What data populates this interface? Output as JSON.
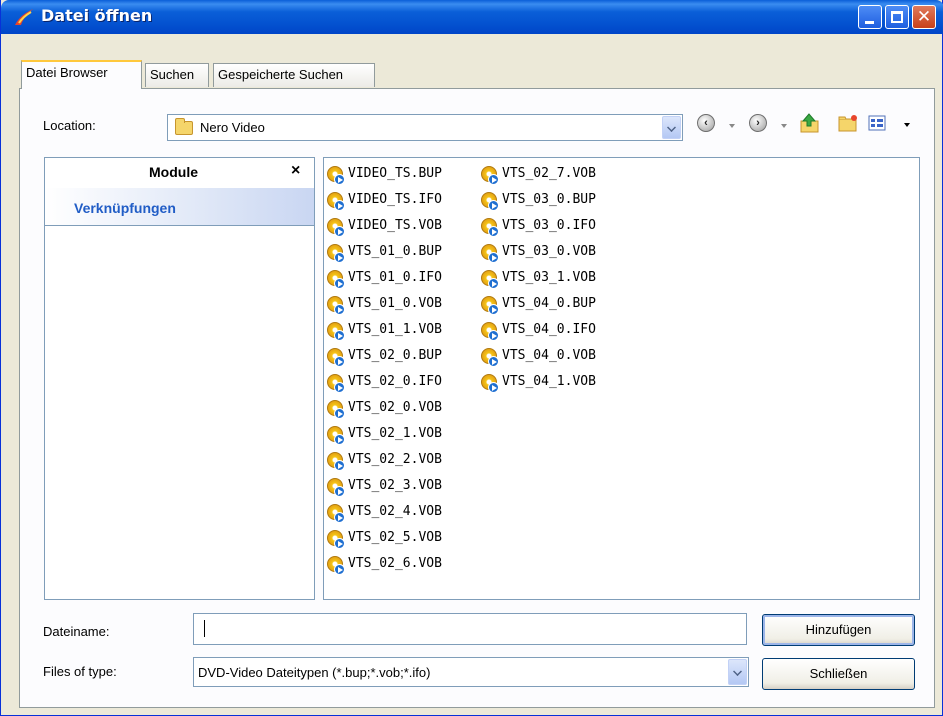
{
  "window": {
    "title": "Datei öffnen"
  },
  "tabs": [
    {
      "label": "Datei Browser",
      "active": true
    },
    {
      "label": "Suchen",
      "active": false
    },
    {
      "label": "Gespeicherte Suchen",
      "active": false
    }
  ],
  "location": {
    "label": "Location:",
    "value": "Nero Video",
    "icon": "folder-icon"
  },
  "toolbar": {
    "icons": [
      "back-icon",
      "forward-icon",
      "up-folder-icon",
      "new-folder-icon",
      "view-menu-icon"
    ]
  },
  "modules": {
    "title": "Module",
    "close_glyph": "×",
    "shortcut_label": "Verknüpfungen"
  },
  "files": {
    "column1": [
      "VIDEO_TS.BUP",
      "VIDEO_TS.IFO",
      "VIDEO_TS.VOB",
      "VTS_01_0.BUP",
      "VTS_01_0.IFO",
      "VTS_01_0.VOB",
      "VTS_01_1.VOB",
      "VTS_02_0.BUP",
      "VTS_02_0.IFO",
      "VTS_02_0.VOB",
      "VTS_02_1.VOB",
      "VTS_02_2.VOB",
      "VTS_02_3.VOB",
      "VTS_02_4.VOB",
      "VTS_02_5.VOB",
      "VTS_02_6.VOB"
    ],
    "column2": [
      "VTS_02_7.VOB",
      "VTS_03_0.BUP",
      "VTS_03_0.IFO",
      "VTS_03_0.VOB",
      "VTS_03_1.VOB",
      "VTS_04_0.BUP",
      "VTS_04_0.IFO",
      "VTS_04_0.VOB",
      "VTS_04_1.VOB"
    ]
  },
  "filename": {
    "label": "Dateiname:",
    "value": ""
  },
  "filetype": {
    "label": "Files of type:",
    "value": "DVD-Video Dateitypen (*.bup;*.vob;*.ifo)"
  },
  "buttons": {
    "add": "Hinzufügen",
    "close": "Schließen"
  }
}
